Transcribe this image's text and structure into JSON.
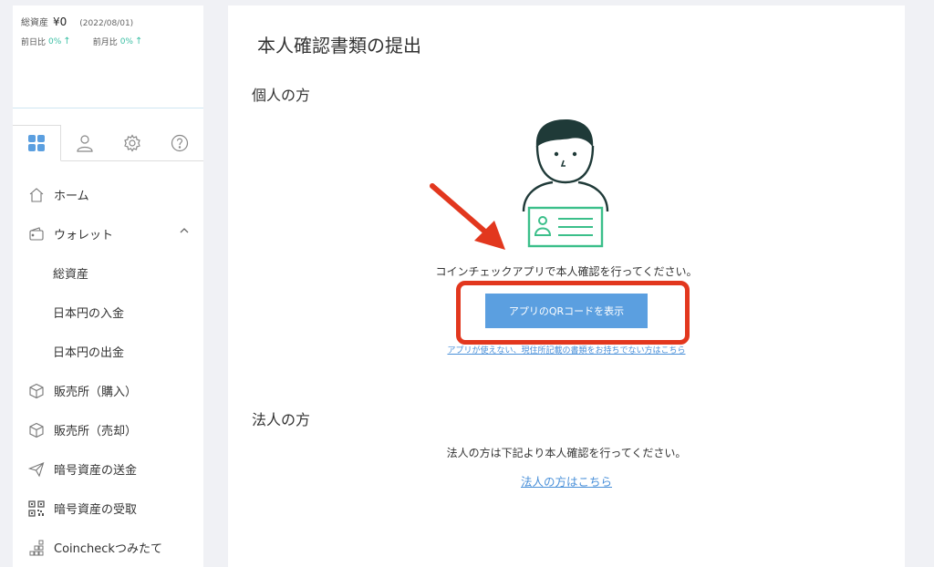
{
  "assets": {
    "label": "総資産",
    "amount": "¥0",
    "date": "(2022/08/01)",
    "daily_label": "前日比",
    "daily_pct": "0%",
    "monthly_label": "前月比",
    "monthly_pct": "0%"
  },
  "tabs": [
    {
      "icon": "grid-icon",
      "active": true
    },
    {
      "icon": "user-icon",
      "active": false
    },
    {
      "icon": "gear-icon",
      "active": false
    },
    {
      "icon": "help-icon",
      "active": false
    }
  ],
  "nav": {
    "home": "ホーム",
    "wallet": "ウォレット",
    "total_assets": "総資産",
    "jpy_deposit": "日本円の入金",
    "jpy_withdraw": "日本円の出金",
    "buy": "販売所（購入）",
    "sell": "販売所（売却）",
    "crypto_send": "暗号資産の送金",
    "crypto_receive": "暗号資産の受取",
    "tsumitate": "Coincheckつみたて"
  },
  "main": {
    "title": "本人確認書類の提出",
    "individual_heading": "個人の方",
    "individual_text": "コインチェックアプリで本人確認を行ってください。",
    "qr_button": "アプリのQRコードを表示",
    "alt_link": "アプリが使えない、現住所記載の書類をお持ちでない方はこちら",
    "corporate_heading": "法人の方",
    "corporate_text": "法人の方は下記より本人確認を行ってください。",
    "corporate_link": "法人の方はこちら"
  },
  "colors": {
    "accent": "#5b9fe0",
    "highlight": "#e2371e",
    "positive": "#3bbfa4",
    "illustration_card": "#3bbf8a"
  }
}
